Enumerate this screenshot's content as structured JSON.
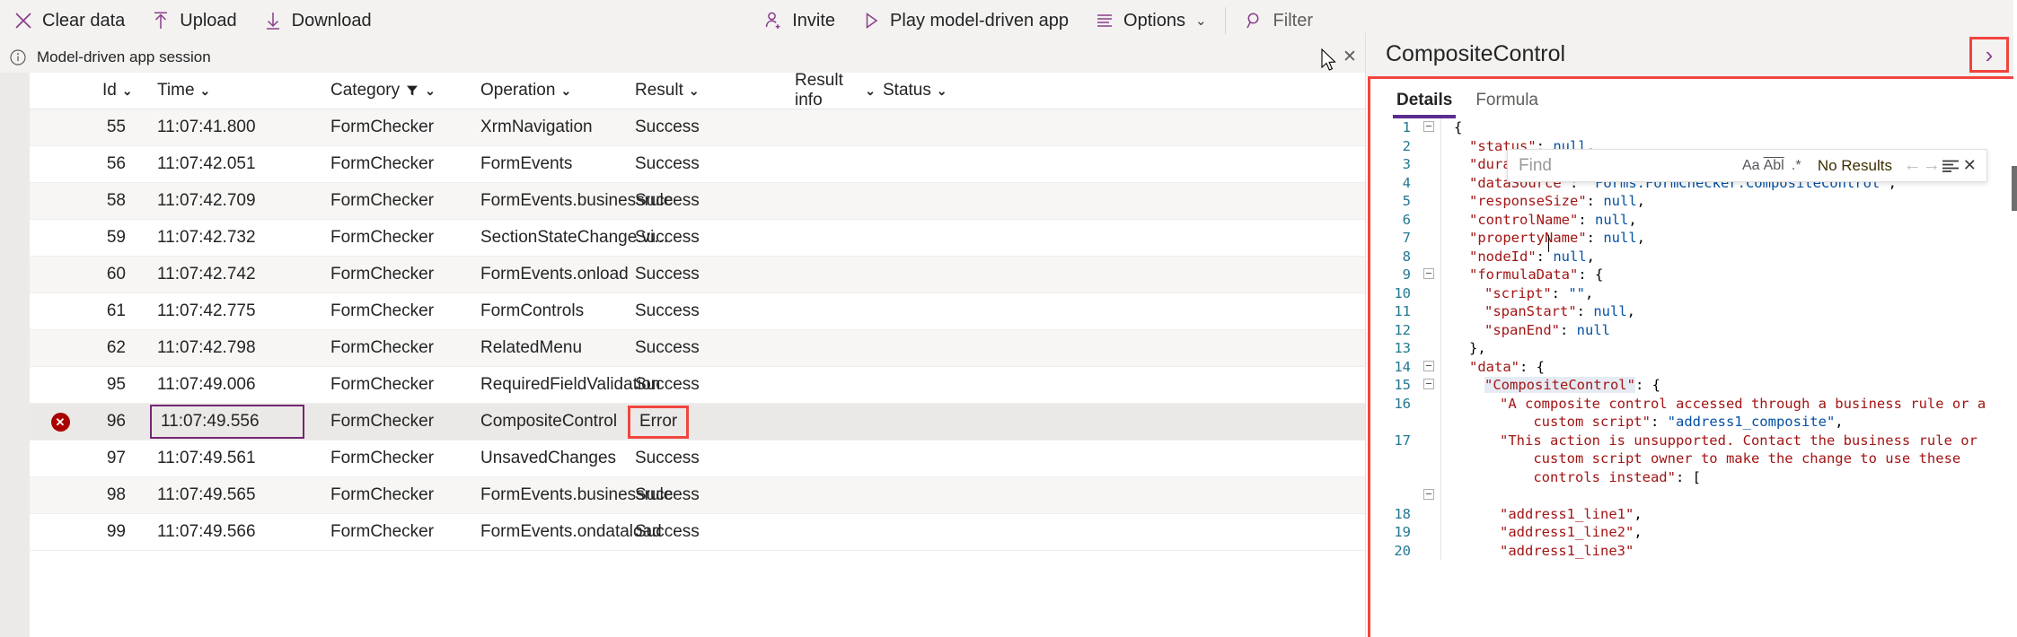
{
  "toolbar": {
    "left_items": [
      {
        "label": "Clear data",
        "icon": "close-x-icon"
      },
      {
        "label": "Upload",
        "icon": "upload-arrow-icon"
      },
      {
        "label": "Download",
        "icon": "download-arrow-icon"
      }
    ],
    "right_items": [
      {
        "label": "Invite",
        "icon": "person-add-icon"
      },
      {
        "label": "Play model-driven app",
        "icon": "play-triangle-icon"
      },
      {
        "label": "Options",
        "icon": "list-lines-icon",
        "chevron": "⌄"
      },
      {
        "label": "Filter",
        "icon": "search-magnifier-icon"
      }
    ]
  },
  "session": {
    "label": "Model-driven app session",
    "info_icon": "info-circle-icon",
    "close_icon": "close-x-icon",
    "close_glyph": "✕"
  },
  "grid": {
    "columns": [
      {
        "key": "id",
        "label": "Id",
        "sort_glyph": "⌄",
        "filtered": false
      },
      {
        "key": "time",
        "label": "Time",
        "sort_glyph": "⌄",
        "filtered": false
      },
      {
        "key": "category",
        "label": "Category",
        "sort_glyph": "⌄",
        "filtered": true
      },
      {
        "key": "operation",
        "label": "Operation",
        "sort_glyph": "⌄",
        "filtered": false
      },
      {
        "key": "result",
        "label": "Result",
        "sort_glyph": "⌄",
        "filtered": false
      },
      {
        "key": "result_info",
        "label": "Result info",
        "sort_glyph": "⌄",
        "filtered": false
      },
      {
        "key": "status",
        "label": "Status",
        "sort_glyph": "⌄",
        "filtered": false
      }
    ],
    "rows": [
      {
        "id": "55",
        "time": "11:07:41.800",
        "category": "FormChecker",
        "operation": "XrmNavigation",
        "result": "Success",
        "result_info": "",
        "status": "",
        "error": false
      },
      {
        "id": "56",
        "time": "11:07:42.051",
        "category": "FormChecker",
        "operation": "FormEvents",
        "result": "Success",
        "result_info": "",
        "status": "",
        "error": false
      },
      {
        "id": "58",
        "time": "11:07:42.709",
        "category": "FormChecker",
        "operation": "FormEvents.businessrule",
        "result": "Success",
        "result_info": "",
        "status": "",
        "error": false
      },
      {
        "id": "59",
        "time": "11:07:42.732",
        "category": "FormChecker",
        "operation": "SectionStateChange.vi...",
        "result": "Success",
        "result_info": "",
        "status": "",
        "error": false
      },
      {
        "id": "60",
        "time": "11:07:42.742",
        "category": "FormChecker",
        "operation": "FormEvents.onload",
        "result": "Success",
        "result_info": "",
        "status": "",
        "error": false
      },
      {
        "id": "61",
        "time": "11:07:42.775",
        "category": "FormChecker",
        "operation": "FormControls",
        "result": "Success",
        "result_info": "",
        "status": "",
        "error": false
      },
      {
        "id": "62",
        "time": "11:07:42.798",
        "category": "FormChecker",
        "operation": "RelatedMenu",
        "result": "Success",
        "result_info": "",
        "status": "",
        "error": false
      },
      {
        "id": "95",
        "time": "11:07:49.006",
        "category": "FormChecker",
        "operation": "RequiredFieldValidation",
        "result": "Success",
        "result_info": "",
        "status": "",
        "error": false
      },
      {
        "id": "96",
        "time": "11:07:49.556",
        "category": "FormChecker",
        "operation": "CompositeControl",
        "result": "Error",
        "result_info": "",
        "status": "",
        "error": true
      },
      {
        "id": "97",
        "time": "11:07:49.561",
        "category": "FormChecker",
        "operation": "UnsavedChanges",
        "result": "Success",
        "result_info": "",
        "status": "",
        "error": false
      },
      {
        "id": "98",
        "time": "11:07:49.565",
        "category": "FormChecker",
        "operation": "FormEvents.businessrule",
        "result": "Success",
        "result_info": "",
        "status": "",
        "error": false
      },
      {
        "id": "99",
        "time": "11:07:49.566",
        "category": "FormChecker",
        "operation": "FormEvents.ondataload",
        "result": "Success",
        "result_info": "",
        "status": "",
        "error": false
      }
    ],
    "error_badge_glyph": "✕"
  },
  "details_panel": {
    "title": "CompositeControl",
    "expand_icon": "chevron-right-icon",
    "expand_glyph": "›",
    "tabs": [
      {
        "label": "Details",
        "active": true
      },
      {
        "label": "Formula",
        "active": false
      }
    ],
    "find": {
      "placeholder": "Find",
      "value": "",
      "match_case_icon": "Aa",
      "match_word_icon": "Abl",
      "regex_icon": ".*",
      "results_text": "No Results",
      "prev_glyph": "←",
      "next_glyph": "→",
      "selection_glyph": "≡",
      "close_glyph": "✕"
    },
    "code_lines": [
      {
        "num": "1",
        "fold": true,
        "indent": 0,
        "tokens": [
          {
            "t": "{",
            "c": "p"
          }
        ]
      },
      {
        "num": "2",
        "fold": false,
        "indent": 1,
        "tokens": [
          {
            "t": "\"status\"",
            "c": "k"
          },
          {
            "t": ": ",
            "c": "p"
          },
          {
            "t": "null",
            "c": "v"
          },
          {
            "t": ",",
            "c": "p"
          }
        ]
      },
      {
        "num": "3",
        "fold": false,
        "indent": 1,
        "tokens": [
          {
            "t": "\"duration\"",
            "c": "k"
          },
          {
            "t": ": ",
            "c": "p"
          },
          {
            "t": "null",
            "c": "v"
          },
          {
            "t": ",",
            "c": "p"
          }
        ]
      },
      {
        "num": "4",
        "fold": false,
        "indent": 1,
        "tokens": [
          {
            "t": "\"dataSource\"",
            "c": "k"
          },
          {
            "t": ": ",
            "c": "p"
          },
          {
            "t": "\"Forms.FormChecker.CompositeControl\"",
            "c": "v"
          },
          {
            "t": ",",
            "c": "p"
          }
        ]
      },
      {
        "num": "5",
        "fold": false,
        "indent": 1,
        "tokens": [
          {
            "t": "\"responseSize\"",
            "c": "k"
          },
          {
            "t": ": ",
            "c": "p"
          },
          {
            "t": "null",
            "c": "v"
          },
          {
            "t": ",",
            "c": "p"
          }
        ]
      },
      {
        "num": "6",
        "fold": false,
        "indent": 1,
        "tokens": [
          {
            "t": "\"controlName\"",
            "c": "k"
          },
          {
            "t": ": ",
            "c": "p"
          },
          {
            "t": "null",
            "c": "v"
          },
          {
            "t": ",",
            "c": "p"
          }
        ]
      },
      {
        "num": "7",
        "fold": false,
        "indent": 1,
        "tokens": [
          {
            "t": "\"propertyName\"",
            "c": "k"
          },
          {
            "t": ": ",
            "c": "p"
          },
          {
            "t": "null",
            "c": "v"
          },
          {
            "t": ",",
            "c": "p"
          }
        ]
      },
      {
        "num": "8",
        "fold": false,
        "indent": 1,
        "tokens": [
          {
            "t": "\"nodeId\"",
            "c": "k"
          },
          {
            "t": ": ",
            "c": "p"
          },
          {
            "t": "null",
            "c": "v"
          },
          {
            "t": ",",
            "c": "p"
          }
        ]
      },
      {
        "num": "9",
        "fold": true,
        "indent": 1,
        "tokens": [
          {
            "t": "\"formulaData\"",
            "c": "k"
          },
          {
            "t": ": {",
            "c": "p"
          }
        ]
      },
      {
        "num": "10",
        "fold": false,
        "indent": 2,
        "tokens": [
          {
            "t": "\"script\"",
            "c": "k"
          },
          {
            "t": ": ",
            "c": "p"
          },
          {
            "t": "\"\"",
            "c": "v"
          },
          {
            "t": ",",
            "c": "p"
          }
        ]
      },
      {
        "num": "11",
        "fold": false,
        "indent": 2,
        "tokens": [
          {
            "t": "\"spanStart\"",
            "c": "k"
          },
          {
            "t": ": ",
            "c": "p"
          },
          {
            "t": "null",
            "c": "v"
          },
          {
            "t": ",",
            "c": "p"
          }
        ]
      },
      {
        "num": "12",
        "fold": false,
        "indent": 2,
        "tokens": [
          {
            "t": "\"spanEnd\"",
            "c": "k"
          },
          {
            "t": ": ",
            "c": "p"
          },
          {
            "t": "null",
            "c": "v"
          }
        ]
      },
      {
        "num": "13",
        "fold": false,
        "indent": 1,
        "tokens": [
          {
            "t": "},",
            "c": "p"
          }
        ]
      },
      {
        "num": "14",
        "fold": true,
        "indent": 1,
        "tokens": [
          {
            "t": "\"data\"",
            "c": "k"
          },
          {
            "t": ": {",
            "c": "p"
          }
        ]
      },
      {
        "num": "15",
        "fold": true,
        "indent": 2,
        "tokens": [
          {
            "t": "\"CompositeControl\"",
            "c": "k",
            "hl": true
          },
          {
            "t": ": {",
            "c": "p"
          }
        ]
      },
      {
        "num": "16",
        "fold": false,
        "indent": 3,
        "tokens": [
          {
            "t": "\"A composite control accessed through a business rule or a\n    custom script\"",
            "c": "k"
          },
          {
            "t": ": ",
            "c": "p"
          },
          {
            "t": "\"address1_composite\"",
            "c": "v"
          },
          {
            "t": ",",
            "c": "p"
          }
        ]
      },
      {
        "num": "17",
        "fold": false,
        "indent": 3,
        "tokens": [
          {
            "t": "\"This action is unsupported. Contact the business rule or\n    custom script owner to make the change to use these\n    controls instead\"",
            "c": "k"
          },
          {
            "t": ": [",
            "c": "p"
          }
        ],
        "fold_below": true
      },
      {
        "num": "18",
        "fold": false,
        "indent": 3,
        "tokens": [
          {
            "t": "\"address1_line1\"",
            "c": "k"
          },
          {
            "t": ",",
            "c": "p"
          }
        ]
      },
      {
        "num": "19",
        "fold": false,
        "indent": 3,
        "tokens": [
          {
            "t": "\"address1_line2\"",
            "c": "k"
          },
          {
            "t": ",",
            "c": "p"
          }
        ]
      },
      {
        "num": "20",
        "fold": false,
        "indent": 3,
        "tokens": [
          {
            "t": "\"address1_line3\"",
            "c": "k"
          }
        ]
      }
    ]
  },
  "colors": {
    "accent_purple": "#742774",
    "brand_purple": "#8b3d8b",
    "highlight_red": "#f0453e",
    "error_red": "#a80000",
    "tab_underline": "#5c2d91",
    "toolbar_bg": "#f3f2f1"
  }
}
